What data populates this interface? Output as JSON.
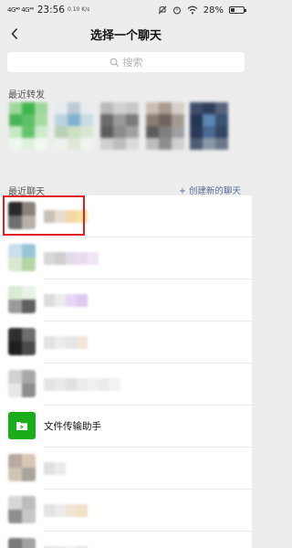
{
  "status_bar": {
    "signal": "4G⁴⁶ 4G⁴⁶",
    "time": "23:56",
    "net_speed": "0.10 K/s",
    "battery": "28%",
    "battery_level": 0.28
  },
  "nav": {
    "title": "选择一个聊天"
  },
  "search": {
    "placeholder": "搜索"
  },
  "recent_forward": {
    "label": "最近转发"
  },
  "recent_chats": {
    "label": "最近聊天",
    "create_link": "+ 创建新的聊天"
  },
  "file_helper": {
    "name": "文件传输助手"
  },
  "colors": {
    "accent_link": "#576b95",
    "wechat_green": "#1aad19",
    "highlight_red": "#e02020"
  },
  "icons": [
    "back-icon",
    "search-icon",
    "folder-icon",
    "wifi-icon",
    "alarm-icon",
    "mute-icon",
    "battery-icon"
  ]
}
